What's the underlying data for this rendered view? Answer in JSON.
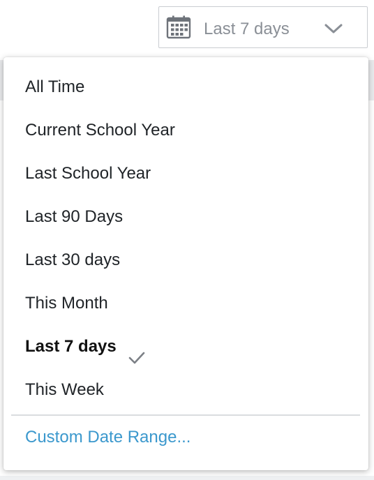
{
  "date_filter": {
    "icon": "calendar-icon",
    "selected_label": "Last 7 days",
    "dropdown_icon": "chevron-down-icon"
  },
  "menu": {
    "items": [
      {
        "label": "All Time",
        "selected": false
      },
      {
        "label": "Current School Year",
        "selected": false
      },
      {
        "label": "Last School Year",
        "selected": false
      },
      {
        "label": "Last 90 Days",
        "selected": false
      },
      {
        "label": "Last 30 days",
        "selected": false
      },
      {
        "label": "This Month",
        "selected": false
      },
      {
        "label": "Last 7 days",
        "selected": true,
        "icon": "checkmark-icon"
      },
      {
        "label": "This Week",
        "selected": false
      }
    ],
    "custom_range_label": "Custom Date Range..."
  },
  "colors": {
    "link": "#3b98cd",
    "text": "#1f2327",
    "muted_text": "#8a8f96",
    "border": "#c9ccd1"
  }
}
